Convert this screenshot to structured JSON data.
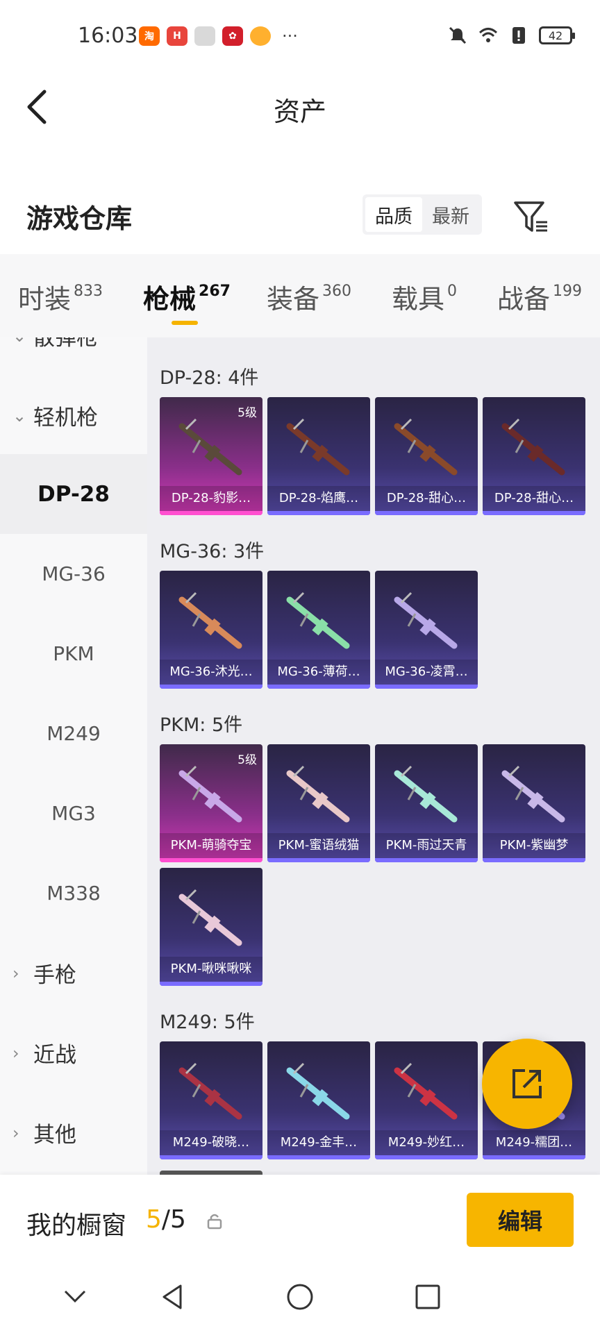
{
  "status": {
    "time": "16:03",
    "battery": "42",
    "app_icons": [
      "taobao-icon",
      "huawei-icon",
      "gift-icon",
      "shop-icon",
      "cat-icon"
    ],
    "more": "···"
  },
  "header": {
    "title": "资产"
  },
  "warehouse": {
    "title": "游戏仓库",
    "sort_options": [
      "品质",
      "最新"
    ]
  },
  "tabs": [
    {
      "label": "时装",
      "count": "833"
    },
    {
      "label": "枪械",
      "count": "267"
    },
    {
      "label": "装备",
      "count": "360"
    },
    {
      "label": "载具",
      "count": "0"
    },
    {
      "label": "战备",
      "count": "199"
    }
  ],
  "sidebar": {
    "partial_top": "散弹枪",
    "category_open": "轻机枪",
    "items": [
      "DP-28",
      "MG-36",
      "PKM",
      "M249",
      "MG3",
      "M338"
    ],
    "categories": [
      "手枪",
      "近战",
      "其他"
    ]
  },
  "groups": [
    {
      "title": "DP-28: 4件",
      "items": [
        {
          "name": "DP-28-豹影…",
          "level": "5级",
          "tier": "pink"
        },
        {
          "name": "DP-28-焰鹰…",
          "level": "",
          "tier": "purple"
        },
        {
          "name": "DP-28-甜心…",
          "level": "",
          "tier": "purple"
        },
        {
          "name": "DP-28-甜心…",
          "level": "",
          "tier": "purple"
        }
      ]
    },
    {
      "title": "MG-36: 3件",
      "items": [
        {
          "name": "MG-36-沐光…",
          "level": "",
          "tier": "purple"
        },
        {
          "name": "MG-36-薄荷…",
          "level": "",
          "tier": "purple"
        },
        {
          "name": "MG-36-凌霄…",
          "level": "",
          "tier": "purple"
        }
      ]
    },
    {
      "title": "PKM: 5件",
      "items": [
        {
          "name": "PKM-萌骑夺宝",
          "level": "5级",
          "tier": "pink"
        },
        {
          "name": "PKM-蜜语绒猫",
          "level": "",
          "tier": "purple"
        },
        {
          "name": "PKM-雨过天青",
          "level": "",
          "tier": "purple"
        },
        {
          "name": "PKM-紫幽梦",
          "level": "",
          "tier": "purple"
        },
        {
          "name": "PKM-啾咪啾咪",
          "level": "",
          "tier": "purple"
        }
      ]
    },
    {
      "title": "M249: 5件",
      "items": [
        {
          "name": "M249-破晓…",
          "level": "",
          "tier": "purple"
        },
        {
          "name": "M249-金丰…",
          "level": "",
          "tier": "purple"
        },
        {
          "name": "M249-妙红…",
          "level": "",
          "tier": "purple"
        },
        {
          "name": "M249-糯团…",
          "level": "",
          "tier": "purple"
        }
      ]
    }
  ],
  "footer": {
    "label": "我的橱窗",
    "count_current": "5",
    "count_sep": "/",
    "count_total": "5",
    "edit": "编辑"
  },
  "colors": {
    "accent": "#f7b500",
    "pink_tier": "#d63ab8",
    "purple_tier": "#5b4fb0"
  }
}
